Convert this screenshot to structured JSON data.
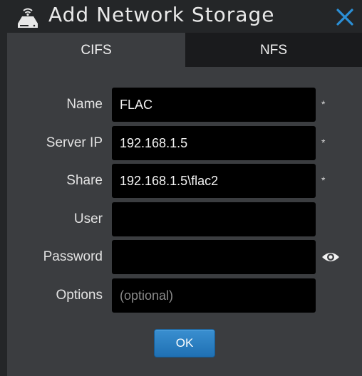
{
  "dialog": {
    "title": "Add Network Storage",
    "icon": "nas-icon",
    "close_icon": "close-icon"
  },
  "tabs": [
    {
      "label": "CIFS",
      "active": true
    },
    {
      "label": "NFS",
      "active": false
    }
  ],
  "form": {
    "name": {
      "label": "Name",
      "value": "FLAC",
      "required_mark": "*"
    },
    "server_ip": {
      "label": "Server IP",
      "value": "192.168.1.5",
      "required_mark": "*"
    },
    "share": {
      "label": "Share",
      "value": "192.168.1.5\\flac2",
      "required_mark": "*"
    },
    "user": {
      "label": "User",
      "value": ""
    },
    "password": {
      "label": "Password",
      "value": "",
      "toggle_icon": "eye-icon"
    },
    "options": {
      "label": "Options",
      "value": "",
      "placeholder": "(optional)"
    }
  },
  "buttons": {
    "ok": "OK"
  },
  "colors": {
    "accent": "#1f70b3",
    "close": "#2b8fd6",
    "background": "#242628",
    "panel": "#3b3d40"
  }
}
